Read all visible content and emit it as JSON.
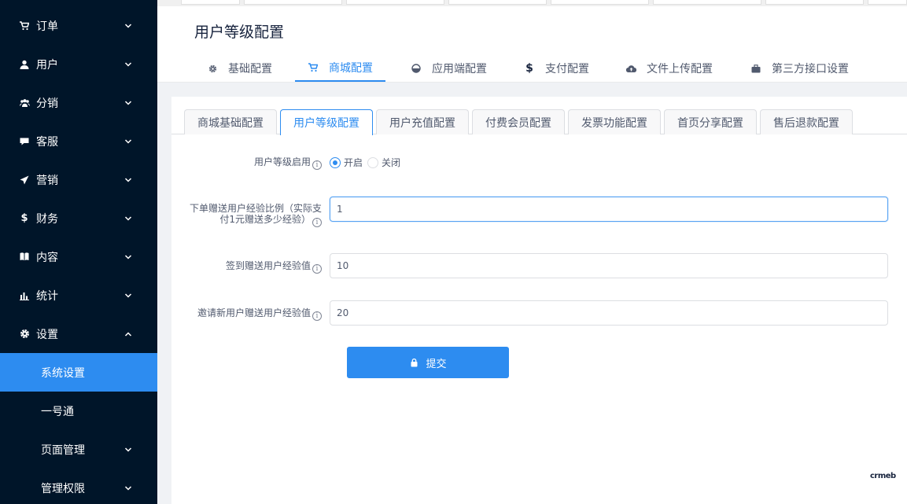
{
  "sidebar": {
    "items": [
      {
        "label": "订单",
        "icon": "cart-icon"
      },
      {
        "label": "用户",
        "icon": "user-icon"
      },
      {
        "label": "分销",
        "icon": "group-icon"
      },
      {
        "label": "客服",
        "icon": "chat-icon"
      },
      {
        "label": "营销",
        "icon": "send-icon"
      },
      {
        "label": "财务",
        "icon": "dollar-icon"
      },
      {
        "label": "内容",
        "icon": "book-icon"
      },
      {
        "label": "统计",
        "icon": "bar-chart-icon"
      },
      {
        "label": "设置",
        "icon": "gear-icon"
      }
    ],
    "sub_items": [
      {
        "label": "系统设置"
      },
      {
        "label": "一号通"
      },
      {
        "label": "页面管理"
      },
      {
        "label": "管理权限"
      }
    ]
  },
  "header": {
    "title": "用户等级配置",
    "tabs": [
      {
        "label": "基础配置",
        "icon": "gear-icon"
      },
      {
        "label": "商城配置",
        "icon": "cart-icon"
      },
      {
        "label": "应用端配置",
        "icon": "dashboard-icon"
      },
      {
        "label": "支付配置",
        "icon": "dollar-icon"
      },
      {
        "label": "文件上传配置",
        "icon": "cloud-upload-icon"
      },
      {
        "label": "第三方接口设置",
        "icon": "briefcase-icon"
      }
    ]
  },
  "sub_tabs": [
    {
      "label": "商城基础配置"
    },
    {
      "label": "用户等级配置"
    },
    {
      "label": "用户充值配置"
    },
    {
      "label": "付费会员配置"
    },
    {
      "label": "发票功能配置"
    },
    {
      "label": "首页分享配置"
    },
    {
      "label": "售后退款配置"
    }
  ],
  "form": {
    "level_enable": {
      "label": "用户等级启用",
      "option_on": "开启",
      "option_off": "关闭",
      "selected": "开启"
    },
    "order_exp": {
      "label_line1": "下单赠送用户经验比例（实际支",
      "label_line2": "付1元赠送多少经验）",
      "value": "1"
    },
    "sign_exp": {
      "label": "签到赠送用户经验值",
      "value": "10"
    },
    "invite_exp": {
      "label": "邀请新用户赠送用户经验值",
      "value": "20"
    },
    "submit_label": "提交",
    "info_glyph": "i"
  },
  "brand": "crmeb",
  "colors": {
    "sidebar_bg": "#001529",
    "accent": "#2d8cf0"
  }
}
